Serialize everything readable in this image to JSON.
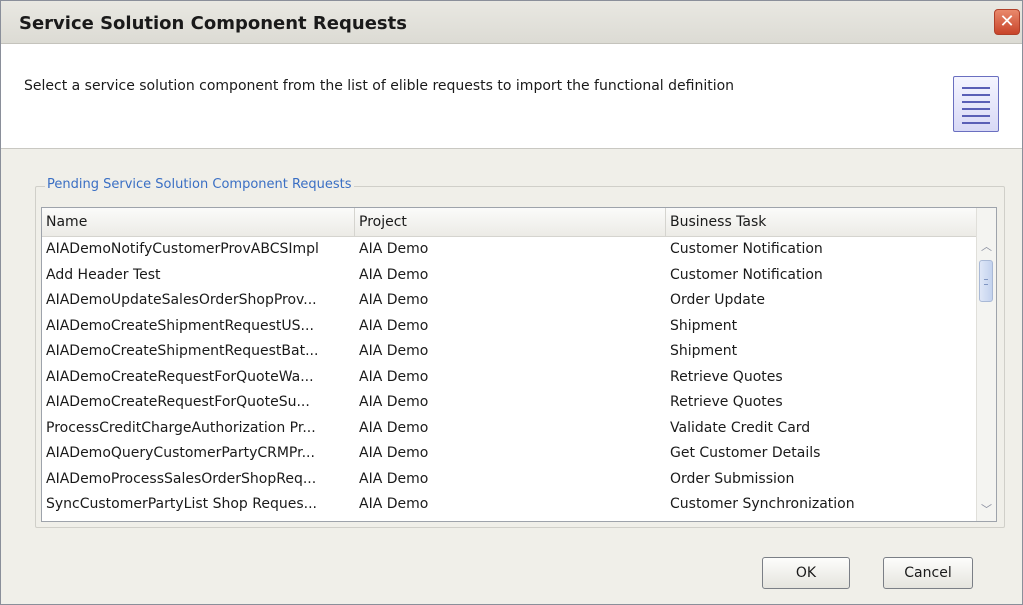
{
  "window": {
    "title": "Service Solution Component Requests",
    "close_glyph": "✕"
  },
  "header": {
    "description": "Select a service solution component from the list of elible requests to import the functional definition",
    "icon": "document-lines-icon"
  },
  "group": {
    "label": "Pending Service Solution Component Requests"
  },
  "table": {
    "columns": [
      "Name",
      "Project",
      "Business Task"
    ],
    "rows": [
      {
        "name": "AIADemoNotifyCustomerProvABCSImpl",
        "project": "AIA Demo",
        "task": "Customer Notification"
      },
      {
        "name": "Add Header Test",
        "project": "AIA Demo",
        "task": "Customer Notification"
      },
      {
        "name": "AIADemoUpdateSalesOrderShopProv...",
        "project": "AIA Demo",
        "task": "Order Update"
      },
      {
        "name": "AIADemoCreateShipmentRequestUS...",
        "project": "AIA Demo",
        "task": "Shipment"
      },
      {
        "name": "AIADemoCreateShipmentRequestBat...",
        "project": "AIA Demo",
        "task": "Shipment"
      },
      {
        "name": "AIADemoCreateRequestForQuoteWa...",
        "project": "AIA Demo",
        "task": "Retrieve Quotes"
      },
      {
        "name": "AIADemoCreateRequestForQuoteSu...",
        "project": "AIA Demo",
        "task": "Retrieve Quotes"
      },
      {
        "name": "ProcessCreditChargeAuthorization Pr...",
        "project": "AIA Demo",
        "task": "Validate Credit Card"
      },
      {
        "name": "AIADemoQueryCustomerPartyCRMPr...",
        "project": "AIA Demo",
        "task": "Get Customer Details"
      },
      {
        "name": "AIADemoProcessSalesOrderShopReq...",
        "project": "AIA Demo",
        "task": "Order Submission"
      },
      {
        "name": "SyncCustomerPartyList Shop Reques...",
        "project": "AIA Demo",
        "task": "Customer Synchronization"
      }
    ]
  },
  "buttons": {
    "ok": "OK",
    "cancel": "Cancel"
  },
  "scrollbar": {
    "up_glyph": "︿",
    "down_glyph": "﹀"
  }
}
